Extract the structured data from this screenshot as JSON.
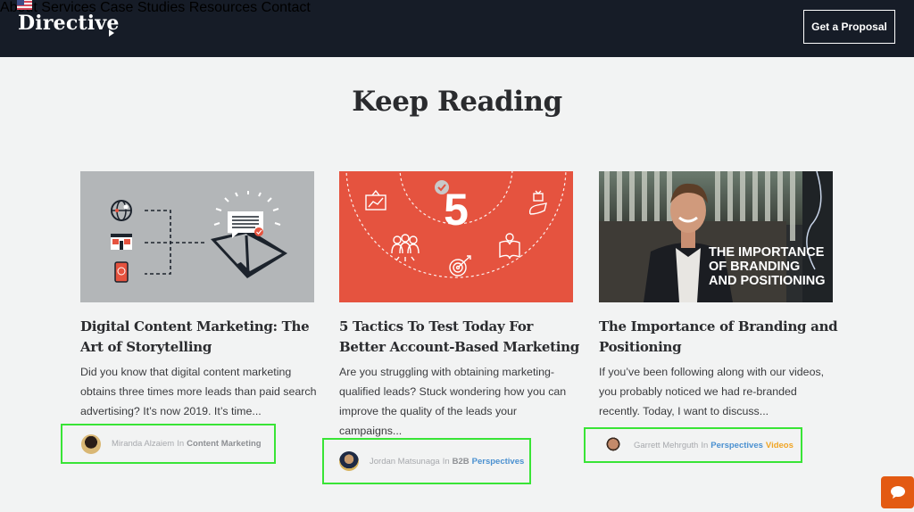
{
  "header": {
    "logo_text": "Directive",
    "nav_items": [
      {
        "label": "About"
      },
      {
        "label": "Services"
      },
      {
        "label": "Case Studies"
      },
      {
        "label": "Resources"
      },
      {
        "label": "Contact"
      }
    ],
    "cta_label": "Get a Proposal",
    "background": "#161c27"
  },
  "section": {
    "title": "Keep Reading"
  },
  "cards": [
    {
      "title": "Digital Content Marketing: The Art of Storytelling",
      "excerpt": "Did you know that digital content marketing obtains three times more leads than paid search advertising? It’s now 2019. It’s time...",
      "author": "Miranda Alzaiem",
      "in_label": "In",
      "categories": [
        {
          "label": "Content Marketing",
          "color": "#8e9094"
        }
      ],
      "image": {
        "type": "illustration",
        "description": "globe, webpage and phone icons connected to an open book with a speech bubble",
        "background": "#b3b6b8"
      }
    },
    {
      "title": "5 Tactics To Test Today For Better Account-Based Marketing",
      "excerpt": "Are you struggling with obtaining marketing-qualified leads? Stuck wondering how you can improve the quality of the leads your campaigns...",
      "author": "Jordan Matsunaga",
      "in_label": "In",
      "categories": [
        {
          "label": "B2B",
          "color": "#8e9094"
        },
        {
          "label": "Perspectives",
          "color": "#4a90d0"
        }
      ],
      "image": {
        "type": "illustration",
        "number": "5",
        "description": "large number 5 with check, surrounded by marketing icons on dashed arcs",
        "background": "#e5533f"
      }
    },
    {
      "title": "The Importance of Branding and Positioning",
      "excerpt": "If you’ve been following along with our videos, you probably noticed we had re-branded recently. Today, I want to discuss...",
      "author": "Garrett Mehrguth",
      "in_label": "In",
      "categories": [
        {
          "label": "Perspectives",
          "color": "#4a90d0"
        },
        {
          "label": "Videos",
          "color": "#f0a424"
        }
      ],
      "image": {
        "type": "photo",
        "overlay_text": [
          "THE IMPORTANCE",
          "OF BRANDING",
          "AND POSITIONING"
        ]
      }
    }
  ],
  "chat_widget": {
    "icon": "chat-bubble-icon",
    "color": "#e35a12"
  },
  "highlight_color": "#39e436"
}
